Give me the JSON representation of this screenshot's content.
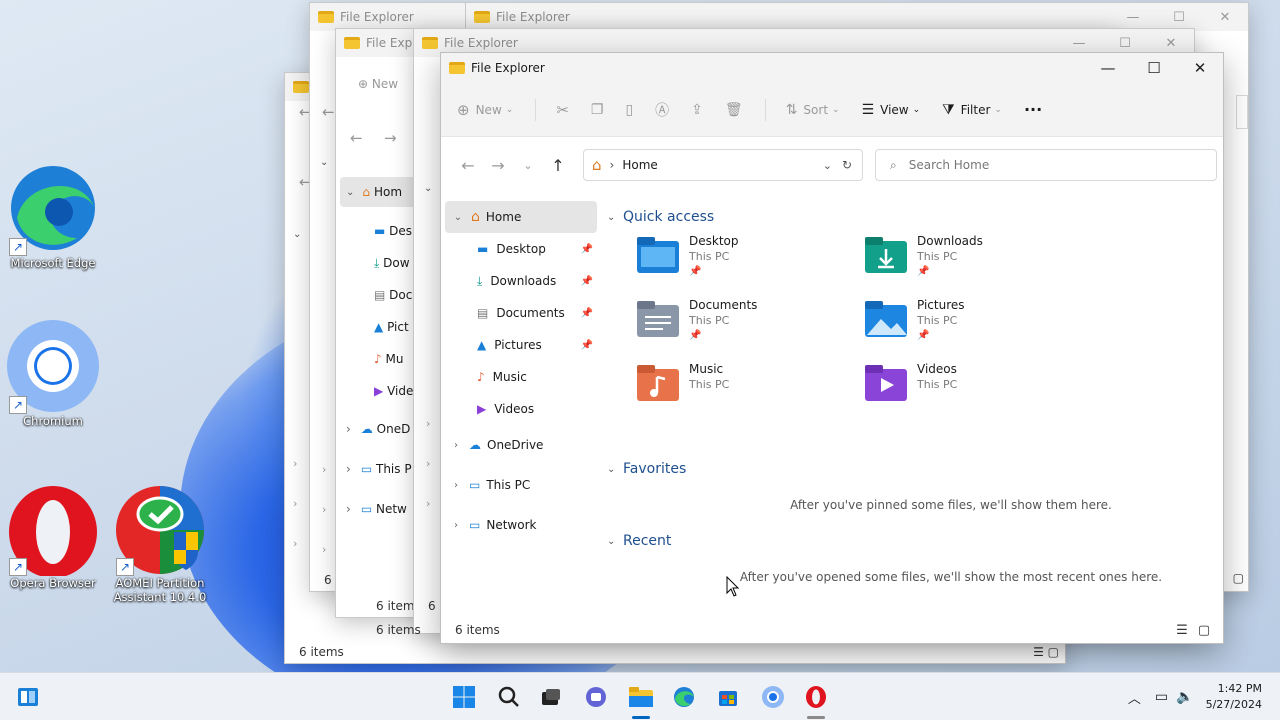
{
  "desktop": {
    "icons": [
      {
        "label": "Microsoft Edge"
      },
      {
        "label": "Chromium"
      },
      {
        "label": "Opera Browser"
      },
      {
        "label": "AOMEI Partition Assistant 10.4.0"
      }
    ]
  },
  "back_windows": {
    "title": "File Explorer",
    "title_short": "File Explo",
    "nav_home": "Hom",
    "nav_items": [
      "Des",
      "Dow",
      "Doc",
      "Pict",
      "Mu",
      "Vide",
      "OneD",
      "This P",
      "Netw"
    ],
    "status_6": "6 items",
    "status_6_short": "6 i",
    "new_label": "New"
  },
  "main": {
    "title": "File Explorer",
    "toolbar": {
      "new_label": "New",
      "sort_label": "Sort",
      "view_label": "View",
      "filter_label": "Filter",
      "more_label": "···"
    },
    "address": {
      "location": "Home"
    },
    "search": {
      "placeholder": "Search Home"
    },
    "nav": {
      "home": "Home",
      "pinned": [
        {
          "label": "Desktop"
        },
        {
          "label": "Downloads"
        },
        {
          "label": "Documents"
        },
        {
          "label": "Pictures"
        },
        {
          "label": "Music"
        },
        {
          "label": "Videos"
        }
      ],
      "onedrive": "OneDrive",
      "thispc": "This PC",
      "network": "Network"
    },
    "quick_access": {
      "heading": "Quick access",
      "items": [
        {
          "name": "Desktop",
          "sub": "This PC"
        },
        {
          "name": "Downloads",
          "sub": "This PC"
        },
        {
          "name": "Documents",
          "sub": "This PC"
        },
        {
          "name": "Pictures",
          "sub": "This PC"
        },
        {
          "name": "Music",
          "sub": "This PC"
        },
        {
          "name": "Videos",
          "sub": "This PC"
        }
      ]
    },
    "favorites": {
      "heading": "Favorites",
      "empty": "After you've pinned some files, we'll show them here."
    },
    "recent": {
      "heading": "Recent",
      "empty": "After you've opened some files, we'll show the most recent ones here."
    },
    "status": "6 items"
  },
  "taskbar": {
    "time": "1:42 PM",
    "date": "5/27/2024"
  },
  "colors": {
    "folder": "#f4c531",
    "accent": "#0067c0",
    "blue_folder": "#1a7fd6",
    "teal_folder": "#0f9d8a"
  }
}
